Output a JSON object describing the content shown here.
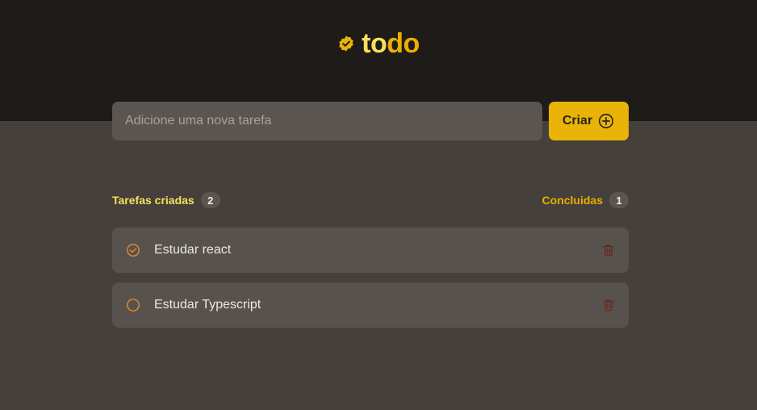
{
  "header": {
    "logo_part1": "to",
    "logo_part2": "do",
    "logo_icon": "verified-badge-icon"
  },
  "new_task": {
    "placeholder": "Adicione uma nova tarefa",
    "value": "",
    "create_label": "Criar",
    "create_icon": "plus-circle-icon"
  },
  "counters": {
    "created_label": "Tarefas criadas",
    "created_count": "2",
    "done_label": "Concluidas",
    "done_count": "1"
  },
  "tasks": [
    {
      "text": "Estudar react",
      "done": true
    },
    {
      "text": "Estudar Typescript",
      "done": false
    }
  ],
  "colors": {
    "header_bg": "#1f1b18",
    "page_bg": "#45403b",
    "accent": "#e9b308",
    "accent_light": "#f7e05c",
    "check_color": "#e58a2e",
    "trash_color": "#6b2a1c"
  }
}
